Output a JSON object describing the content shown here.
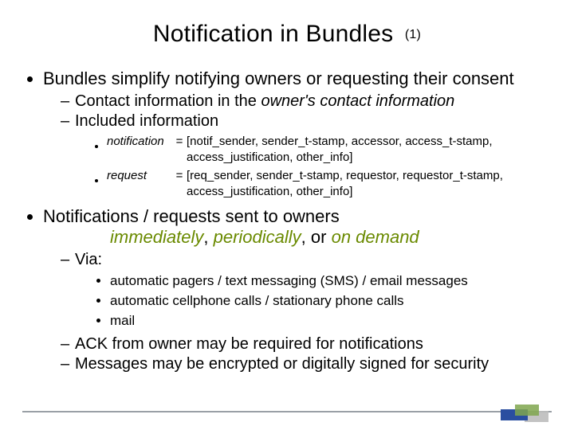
{
  "title": "Notification in Bundles",
  "title_sub": "(1)",
  "b1_1": "Bundles simplify notifying owners or requesting their consent",
  "b2_1": "Contact information in the ",
  "b2_1_em": "owner's contact information",
  "b2_2": "Included information",
  "def": {
    "t1": "notification",
    "eq": "=",
    "v1a": "[notif_sender, sender_t-stamp, accessor, access_t-stamp,",
    "v1b": "access_justification, other_info]",
    "t2": "request",
    "v2a": "[req_sender, sender_t-stamp, requestor, requestor_t-stamp,",
    "v2b": "access_justification, other_info]"
  },
  "b1_2": "Notifications / requests sent to owners",
  "modes_line": {
    "w1": "immediately",
    "sep": ", ",
    "w2": "periodically",
    "mid": ", or ",
    "w3": "on demand"
  },
  "b2_3": "Via:",
  "via1": "automatic pagers / text messaging (SMS) / email messages",
  "via2": "automatic cellphone calls / stationary phone calls",
  "via3": "mail",
  "b2_4": "ACK from owner may be required for notifications",
  "b2_5": "Messages may be encrypted or digitally signed for security"
}
